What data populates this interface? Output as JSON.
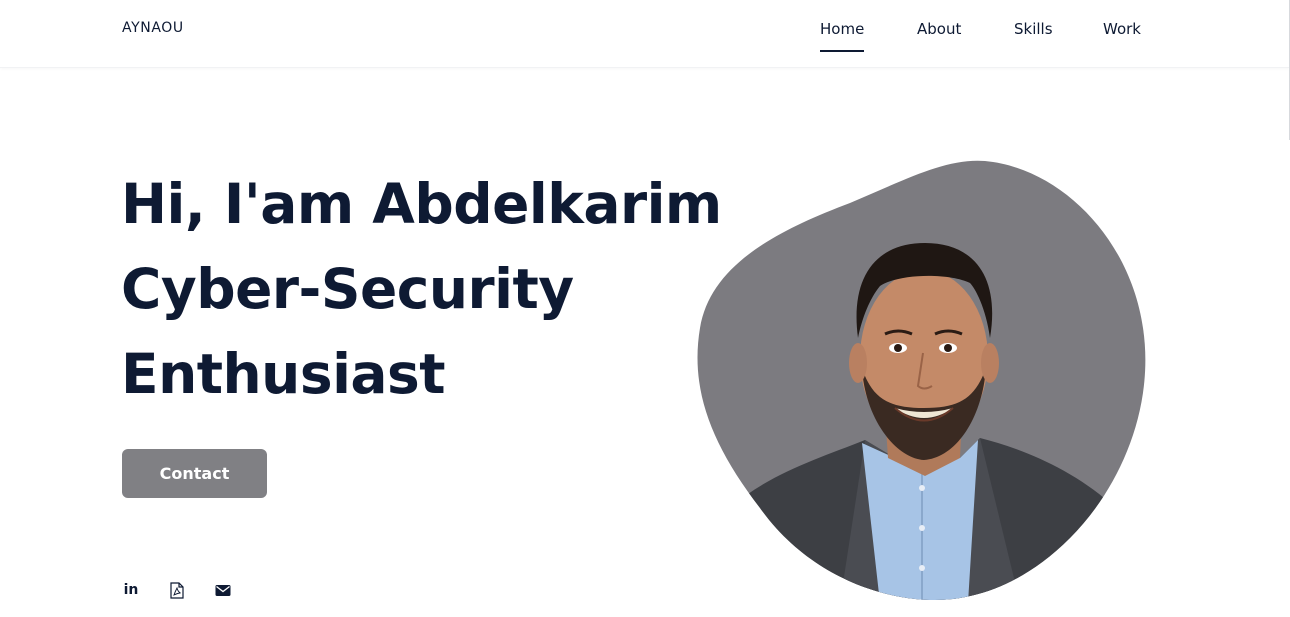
{
  "header": {
    "logo": "AYNAOU",
    "nav": [
      {
        "label": "Home",
        "active": true
      },
      {
        "label": "About",
        "active": false
      },
      {
        "label": "Skills",
        "active": false
      },
      {
        "label": "Work",
        "active": false
      }
    ]
  },
  "hero": {
    "title_line1": "Hi, I'am Abdelkarim",
    "title_line2": "Cyber-Security",
    "title_line3": "Enthusiast",
    "contact_label": "Contact"
  },
  "socials": {
    "linkedin_label": "in",
    "icons": [
      "linkedin-icon",
      "pdf-file-icon",
      "envelope-icon"
    ]
  },
  "portrait": {
    "blob_color": "#7c7b80",
    "description_icon": "profile-photo"
  },
  "colors": {
    "primary_text": "#0e1a33",
    "button_bg": "#808084",
    "button_text": "#ffffff"
  }
}
